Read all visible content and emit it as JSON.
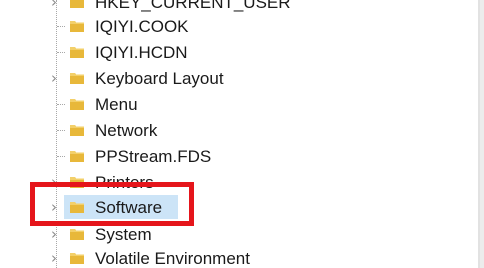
{
  "registry_tree": {
    "items": [
      {
        "label": "HKEY_CURRENT_USER",
        "expandable": true,
        "selected": false
      },
      {
        "label": "IQIYI.COOK",
        "expandable": false,
        "selected": false
      },
      {
        "label": "IQIYI.HCDN",
        "expandable": false,
        "selected": false
      },
      {
        "label": "Keyboard Layout",
        "expandable": true,
        "selected": false
      },
      {
        "label": "Menu",
        "expandable": false,
        "selected": false
      },
      {
        "label": "Network",
        "expandable": false,
        "selected": false
      },
      {
        "label": "PPStream.FDS",
        "expandable": false,
        "selected": false
      },
      {
        "label": "Printers",
        "expandable": true,
        "selected": false
      },
      {
        "label": "Software",
        "expandable": true,
        "selected": true
      },
      {
        "label": "System",
        "expandable": true,
        "selected": false
      },
      {
        "label": "Volatile Environment",
        "expandable": true,
        "selected": false
      }
    ]
  },
  "colors": {
    "folder": "#e8b83a",
    "selection": "#cce4f7",
    "highlight_box": "#e5151b"
  },
  "icons": {
    "chevron": "chevron-right-icon",
    "folder": "folder-icon"
  }
}
